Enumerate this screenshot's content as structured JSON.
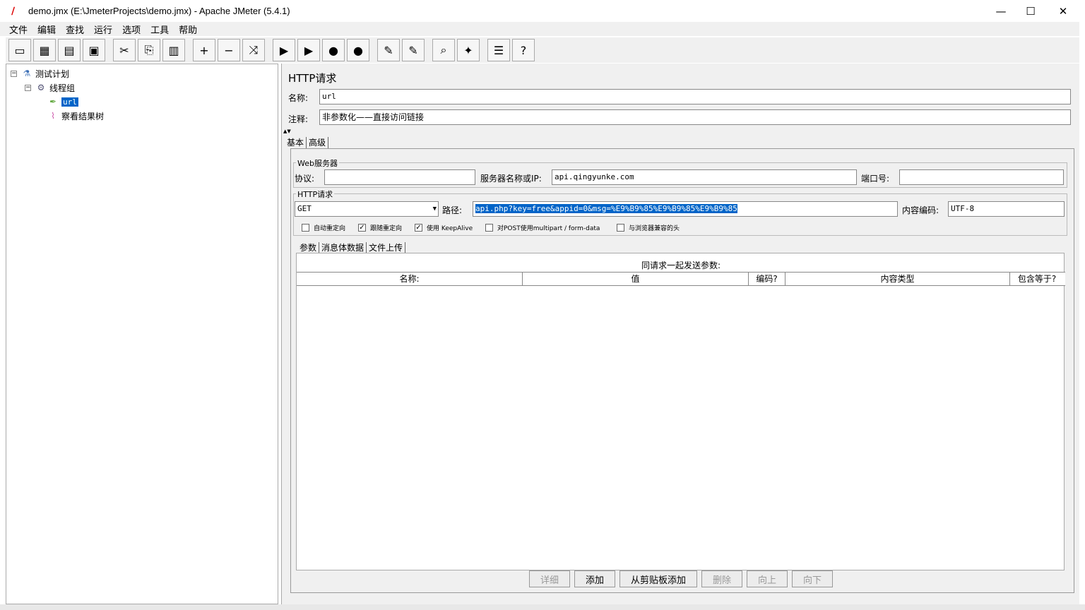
{
  "window": {
    "title": "demo.jmx (E:\\JmeterProjects\\demo.jmx) - Apache JMeter (5.4.1)"
  },
  "menu": [
    "文件",
    "编辑",
    "查找",
    "运行",
    "选项",
    "工具",
    "帮助"
  ],
  "toolbar": [
    {
      "name": "new-icon",
      "glyph": "▭"
    },
    {
      "name": "templates-icon",
      "glyph": "▦"
    },
    {
      "name": "open-icon",
      "glyph": "▤"
    },
    {
      "name": "save-icon",
      "glyph": "▣"
    },
    {
      "name": "cut-icon",
      "glyph": "✂"
    },
    {
      "name": "copy-icon",
      "glyph": "⎘"
    },
    {
      "name": "paste-icon",
      "glyph": "▥"
    },
    {
      "name": "expand-icon",
      "glyph": "+"
    },
    {
      "name": "collapse-icon",
      "glyph": "−"
    },
    {
      "name": "toggle-icon",
      "glyph": "⤨"
    },
    {
      "name": "start-icon",
      "glyph": "▶"
    },
    {
      "name": "start-no-pause-icon",
      "glyph": "▶"
    },
    {
      "name": "stop-icon",
      "glyph": "●"
    },
    {
      "name": "shutdown-icon",
      "glyph": "●"
    },
    {
      "name": "clear-icon",
      "glyph": "✎"
    },
    {
      "name": "clear-all-icon",
      "glyph": "✎"
    },
    {
      "name": "search-icon",
      "glyph": "⌕"
    },
    {
      "name": "reset-search-icon",
      "glyph": "✦"
    },
    {
      "name": "function-helper-icon",
      "glyph": "☰"
    },
    {
      "name": "help-icon",
      "glyph": "?"
    }
  ],
  "tree": {
    "test_plan": "测试计划",
    "thread_group": "线程组",
    "sampler": "url",
    "listener": "察看结果树"
  },
  "panel": {
    "title": "HTTP请求",
    "name_label": "名称:",
    "name_value": "url",
    "comment_label": "注释:",
    "comment_value": "非参数化——直接访问链接",
    "tabs": [
      "基本",
      "高级"
    ],
    "web_server": {
      "title": "Web服务器",
      "protocol_label": "协议:",
      "protocol_value": "",
      "server_label": "服务器名称或IP:",
      "server_value": "api.qingyunke.com",
      "port_label": "端口号:",
      "port_value": ""
    },
    "http_request": {
      "title": "HTTP请求",
      "method": "GET",
      "path_label": "路径:",
      "path_value": "api.php?key=free&appid=0&msg=%E9%B9%85%E9%B9%85%E9%B9%85",
      "encoding_label": "内容编码:",
      "encoding_value": "UTF-8"
    },
    "checkboxes": [
      {
        "label": "自动重定向",
        "checked": false
      },
      {
        "label": "跟随重定向",
        "checked": true
      },
      {
        "label": "使用 KeepAlive",
        "checked": true
      },
      {
        "label": "对POST使用multipart / form-data",
        "checked": false
      },
      {
        "label": "与浏览器兼容的头",
        "checked": false
      }
    ],
    "sub_tabs": [
      "参数",
      "消息体数据",
      "文件上传"
    ],
    "params_title": "同请求一起发送参数:",
    "columns": [
      "名称:",
      "值",
      "编码?",
      "内容类型",
      "包含等于?"
    ],
    "buttons": [
      {
        "label": "详细",
        "enabled": false
      },
      {
        "label": "添加",
        "enabled": true
      },
      {
        "label": "从剪贴板添加",
        "enabled": true
      },
      {
        "label": "删除",
        "enabled": false
      },
      {
        "label": "向上",
        "enabled": false
      },
      {
        "label": "向下",
        "enabled": false
      }
    ]
  }
}
